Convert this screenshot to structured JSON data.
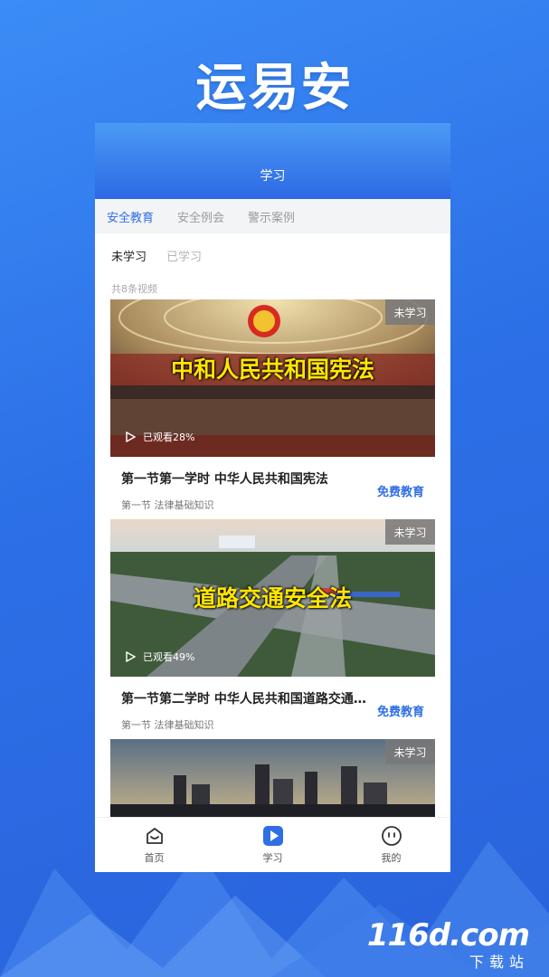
{
  "app_title": "运易安",
  "header": {
    "title": "学习"
  },
  "category_tabs": [
    {
      "label": "安全教育",
      "active": true
    },
    {
      "label": "安全例会",
      "active": false
    },
    {
      "label": "警示案例",
      "active": false
    }
  ],
  "sub_tabs": [
    {
      "label": "未学习",
      "active": true
    },
    {
      "label": "已学习",
      "active": false
    }
  ],
  "count_text": "共8条视频",
  "videos": [
    {
      "badge": "未学习",
      "overlay_title": "中和人民共和国宪法",
      "progress": "已观看28%",
      "title": "第一节第一学时 中华人民共和国宪法",
      "subtitle": "第一节 法律基础知识",
      "tag": "免费教育"
    },
    {
      "badge": "未学习",
      "overlay_title": "道路交通安全法",
      "progress": "已观看49%",
      "title": "第一节第二学时 中华人民共和国道路交通安全法",
      "subtitle": "第一节 法律基础知识",
      "tag": "免费教育"
    },
    {
      "badge": "未学习"
    }
  ],
  "bottom_nav": [
    {
      "label": "首页",
      "icon": "home-icon"
    },
    {
      "label": "学习",
      "icon": "play-icon",
      "active": true
    },
    {
      "label": "我的",
      "icon": "profile-icon"
    }
  ],
  "watermark": {
    "main": "116d.com",
    "sub": "下载站"
  },
  "colors": {
    "accent": "#2f6ee5",
    "badge_bg": "#787878",
    "overlay_text": "#ffe600"
  }
}
